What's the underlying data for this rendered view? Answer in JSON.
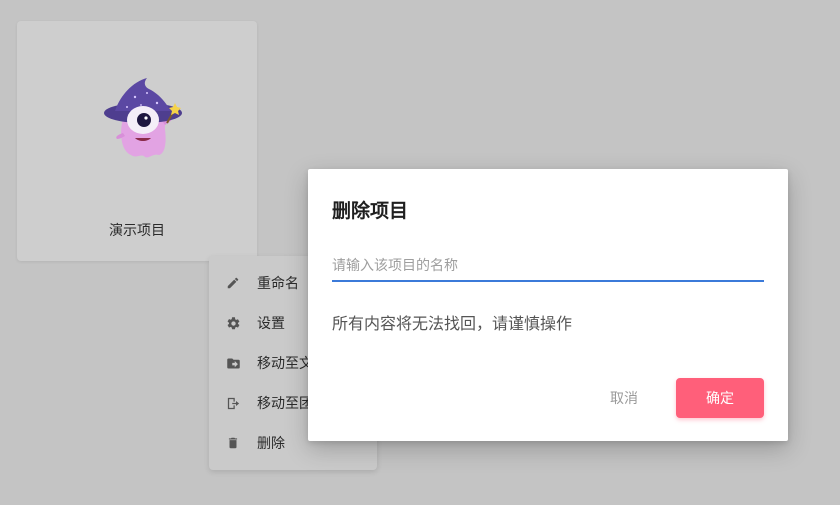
{
  "project_card": {
    "title": "演示项目",
    "art_icon": "wizard-monster-icon"
  },
  "context_menu": {
    "items": [
      {
        "label": "重命名",
        "icon": "pencil-icon"
      },
      {
        "label": "设置",
        "icon": "gear-icon"
      },
      {
        "label": "移动至文",
        "icon": "folder-move-icon"
      },
      {
        "label": "移动至团",
        "icon": "exit-door-icon"
      },
      {
        "label": "删除",
        "icon": "trash-icon"
      }
    ]
  },
  "dialog": {
    "title": "删除项目",
    "input": {
      "value": "",
      "placeholder": "请输入该项目的名称"
    },
    "warning": "所有内容将无法找回，请谨慎操作",
    "cancel_label": "取消",
    "confirm_label": "确定"
  },
  "colors": {
    "backdrop": "#c4c4c4",
    "accent_blue": "#3b7ad9",
    "confirm_pink": "#ff5f7a"
  }
}
